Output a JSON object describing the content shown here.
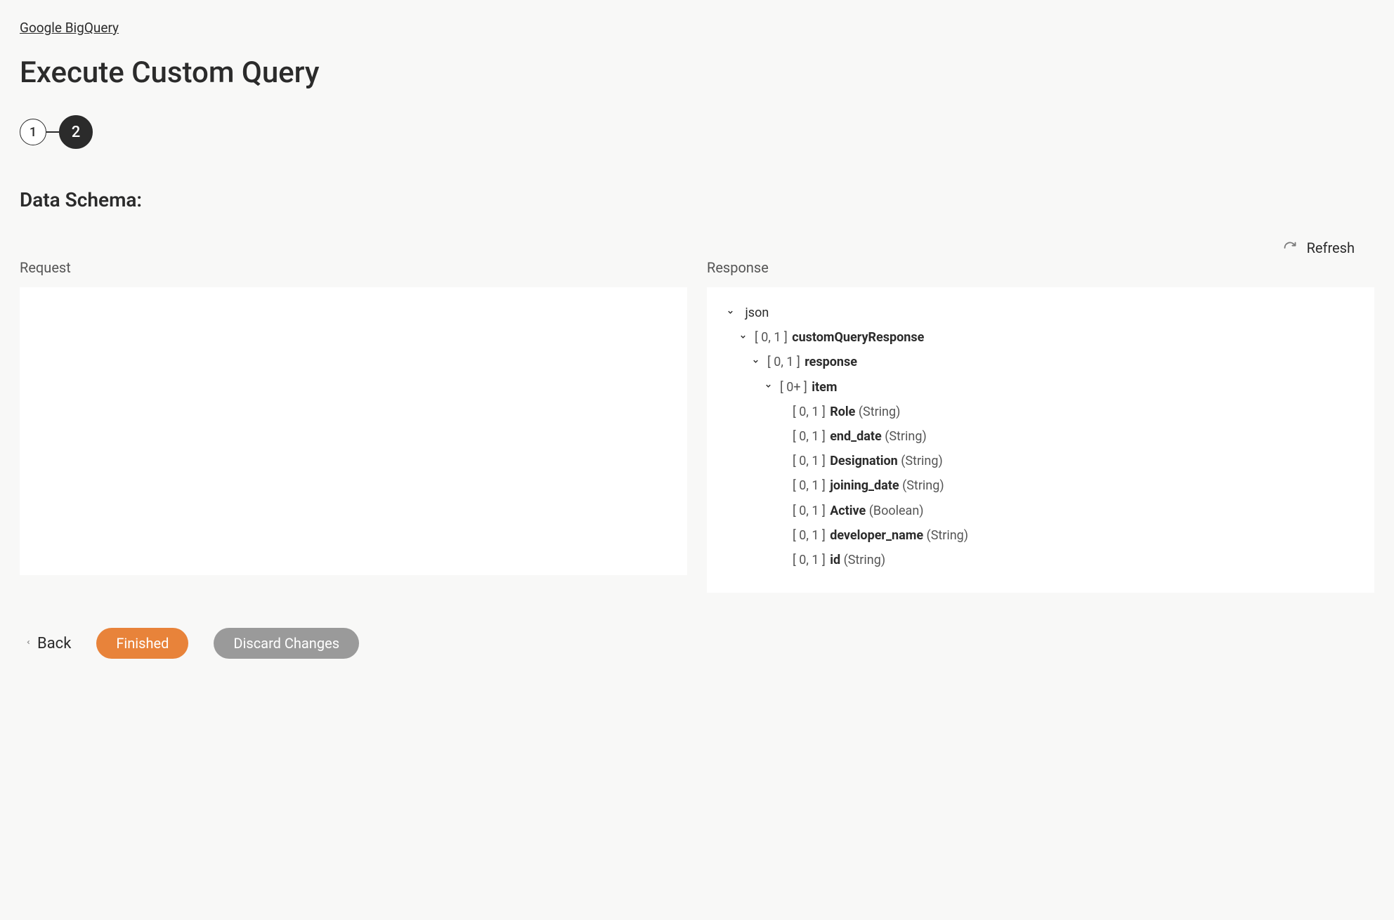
{
  "breadcrumb": "Google BigQuery",
  "title": "Execute Custom Query",
  "stepper": {
    "step1": "1",
    "step2": "2"
  },
  "section": "Data Schema:",
  "refresh": "Refresh",
  "panels": {
    "request_label": "Request",
    "response_label": "Response"
  },
  "tree": {
    "root": "json",
    "nodes": [
      {
        "level": 1,
        "toggle": true,
        "card": "[ 0, 1 ]",
        "name": "customQueryResponse",
        "type": ""
      },
      {
        "level": 2,
        "toggle": true,
        "card": "[ 0, 1 ]",
        "name": "response",
        "type": ""
      },
      {
        "level": 3,
        "toggle": true,
        "card": "[ 0+ ]",
        "name": "item",
        "type": ""
      },
      {
        "level": 4,
        "toggle": false,
        "card": "[ 0, 1 ]",
        "name": "Role",
        "type": "(String)"
      },
      {
        "level": 4,
        "toggle": false,
        "card": "[ 0, 1 ]",
        "name": "end_date",
        "type": "(String)"
      },
      {
        "level": 4,
        "toggle": false,
        "card": "[ 0, 1 ]",
        "name": "Designation",
        "type": "(String)"
      },
      {
        "level": 4,
        "toggle": false,
        "card": "[ 0, 1 ]",
        "name": "joining_date",
        "type": "(String)"
      },
      {
        "level": 4,
        "toggle": false,
        "card": "[ 0, 1 ]",
        "name": "Active",
        "type": "(Boolean)"
      },
      {
        "level": 4,
        "toggle": false,
        "card": "[ 0, 1 ]",
        "name": "developer_name",
        "type": "(String)"
      },
      {
        "level": 4,
        "toggle": false,
        "card": "[ 0, 1 ]",
        "name": "id",
        "type": "(String)"
      }
    ]
  },
  "footer": {
    "back": "Back",
    "finished": "Finished",
    "discard": "Discard Changes"
  }
}
